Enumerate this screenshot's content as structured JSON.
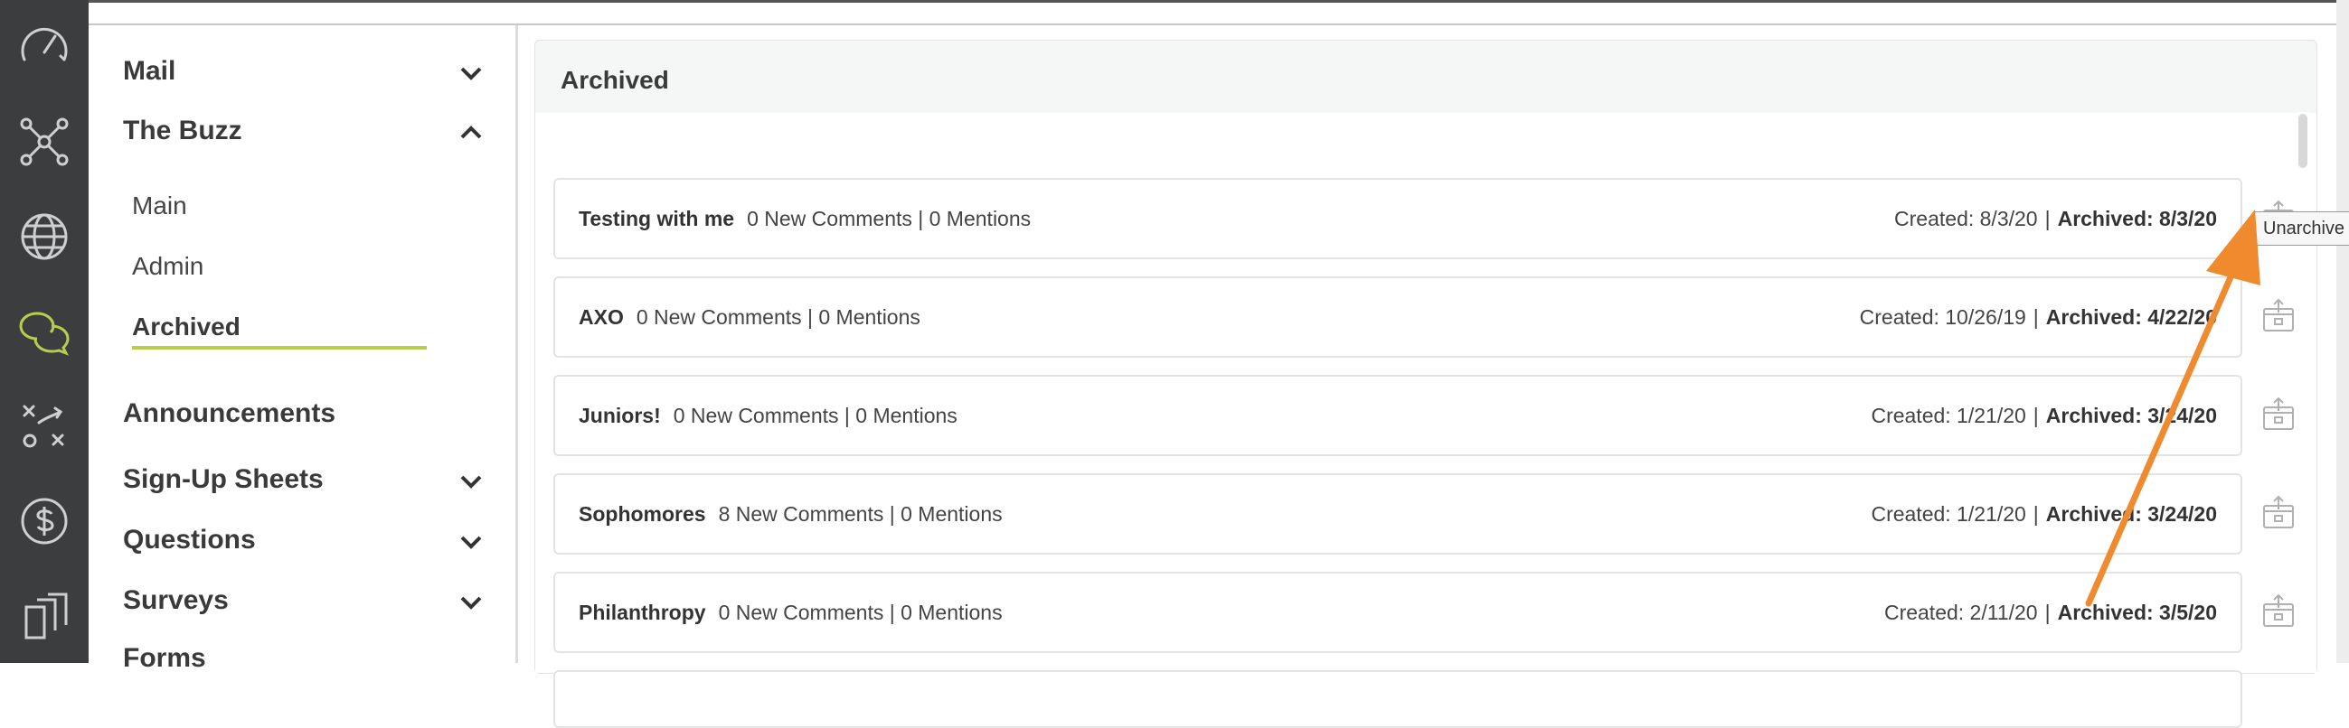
{
  "nav": {
    "mail": "Mail",
    "the_buzz": "The Buzz",
    "buzz_items": [
      "Main",
      "Admin",
      "Archived"
    ],
    "announcements": "Announcements",
    "signup_sheets": "Sign-Up Sheets",
    "questions": "Questions",
    "surveys": "Surveys",
    "forms": "Forms"
  },
  "panel": {
    "title": "Archived",
    "rows": [
      {
        "name": "Testing with me",
        "stats": "0 New Comments | 0 Mentions",
        "created": "Created: 8/3/20",
        "archived": "Archived: 8/3/20"
      },
      {
        "name": "AXO",
        "stats": "0 New Comments | 0 Mentions",
        "created": "Created: 10/26/19",
        "archived": "Archived: 4/22/20"
      },
      {
        "name": "Juniors!",
        "stats": "0 New Comments | 0 Mentions",
        "created": "Created: 1/21/20",
        "archived": "Archived: 3/24/20"
      },
      {
        "name": "Sophomores",
        "stats": "8 New Comments | 0 Mentions",
        "created": "Created: 1/21/20",
        "archived": "Archived: 3/24/20"
      },
      {
        "name": "Philanthropy",
        "stats": "0 New Comments | 0 Mentions",
        "created": "Created: 2/11/20",
        "archived": "Archived: 3/5/20"
      }
    ]
  },
  "tooltip": "Unarchive",
  "colors": {
    "rail": "#3c3d3f",
    "accent": "#b8cd4b",
    "arrow": "#f08a2e"
  }
}
